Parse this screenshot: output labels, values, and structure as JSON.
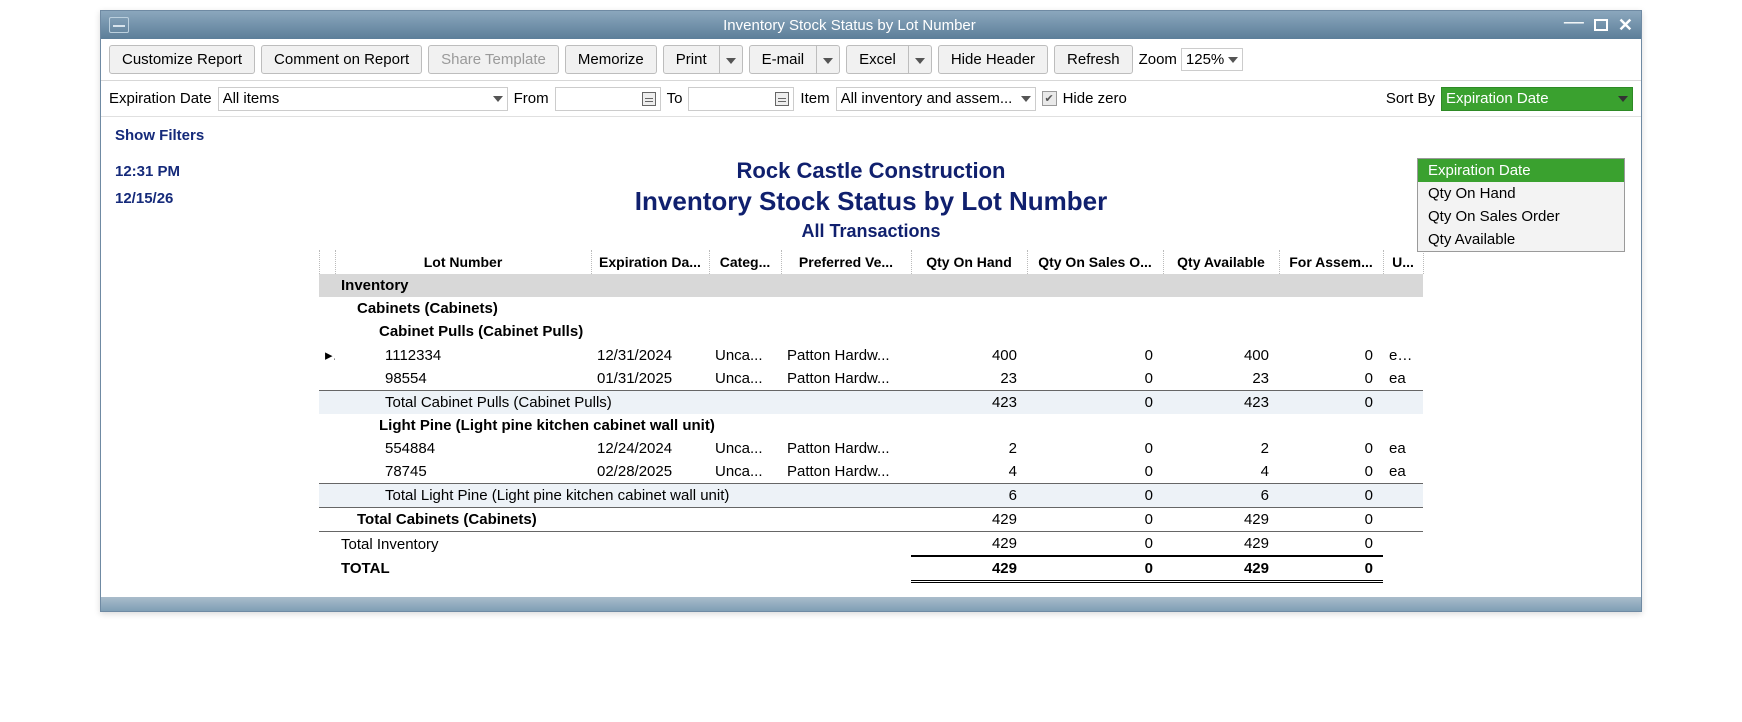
{
  "window": {
    "title": "Inventory Stock Status by Lot Number"
  },
  "toolbar": {
    "customize": "Customize Report",
    "comment": "Comment on Report",
    "share": "Share Template",
    "memorize": "Memorize",
    "print": "Print",
    "email": "E-mail",
    "excel": "Excel",
    "hideheader": "Hide Header",
    "refresh": "Refresh",
    "zoom_label": "Zoom",
    "zoom_value": "125%"
  },
  "filters": {
    "expdate_label": "Expiration Date",
    "expdate_value": "All items",
    "from_label": "From",
    "to_label": "To",
    "item_label": "Item",
    "item_value": "All inventory and assem...",
    "hidezero_label": "Hide zero",
    "sortby_label": "Sort By",
    "sortby_value": "Expiration Date",
    "sort_options": [
      "Expiration Date",
      "Qty On Hand",
      "Qty On Sales Order",
      "Qty Available"
    ]
  },
  "showfilters": "Show Filters",
  "report": {
    "time": "12:31 PM",
    "date": "12/15/26",
    "company": "Rock Castle Construction",
    "title": "Inventory Stock Status by Lot Number",
    "subtitle": "All Transactions"
  },
  "columns": [
    "Lot Number",
    "Expiration Da...",
    "Categ...",
    "Preferred Ve...",
    "Qty On Hand",
    "Qty On Sales O...",
    "Qty Available",
    "For Assem...",
    "U..."
  ],
  "section": "Inventory",
  "groups": [
    {
      "name": "Cabinets (Cabinets)",
      "subs": [
        {
          "name": "Cabinet Pulls (Cabinet Pulls)",
          "rows": [
            {
              "mark": "▸",
              "lot": "1112334",
              "exp": "12/31/2024",
              "cat": "Unca...",
              "ven": "Patton Hardw...",
              "onhand": "400",
              "sales": "0",
              "avail": "400",
              "asm": "0",
              "u": "ea ◂"
            },
            {
              "mark": "",
              "lot": "98554",
              "exp": "01/31/2025",
              "cat": "Unca...",
              "ven": "Patton Hardw...",
              "onhand": "23",
              "sales": "0",
              "avail": "23",
              "asm": "0",
              "u": "ea"
            }
          ],
          "total_label": "Total Cabinet Pulls (Cabinet Pulls)",
          "total": {
            "onhand": "423",
            "sales": "0",
            "avail": "423",
            "asm": "0"
          }
        },
        {
          "name": "Light Pine (Light pine kitchen cabinet wall unit)",
          "rows": [
            {
              "mark": "",
              "lot": "554884",
              "exp": "12/24/2024",
              "cat": "Unca...",
              "ven": "Patton Hardw...",
              "onhand": "2",
              "sales": "0",
              "avail": "2",
              "asm": "0",
              "u": "ea"
            },
            {
              "mark": "",
              "lot": "78745",
              "exp": "02/28/2025",
              "cat": "Unca...",
              "ven": "Patton Hardw...",
              "onhand": "4",
              "sales": "0",
              "avail": "4",
              "asm": "0",
              "u": "ea"
            }
          ],
          "total_label": "Total Light Pine (Light pine kitchen cabinet wall unit)",
          "total": {
            "onhand": "6",
            "sales": "0",
            "avail": "6",
            "asm": "0"
          }
        }
      ],
      "total_label": "Total Cabinets (Cabinets)",
      "total": {
        "onhand": "429",
        "sales": "0",
        "avail": "429",
        "asm": "0"
      }
    }
  ],
  "inv_total_label": "Total Inventory",
  "inv_total": {
    "onhand": "429",
    "sales": "0",
    "avail": "429",
    "asm": "0"
  },
  "grand_label": "TOTAL",
  "grand": {
    "onhand": "429",
    "sales": "0",
    "avail": "429",
    "asm": "0"
  }
}
